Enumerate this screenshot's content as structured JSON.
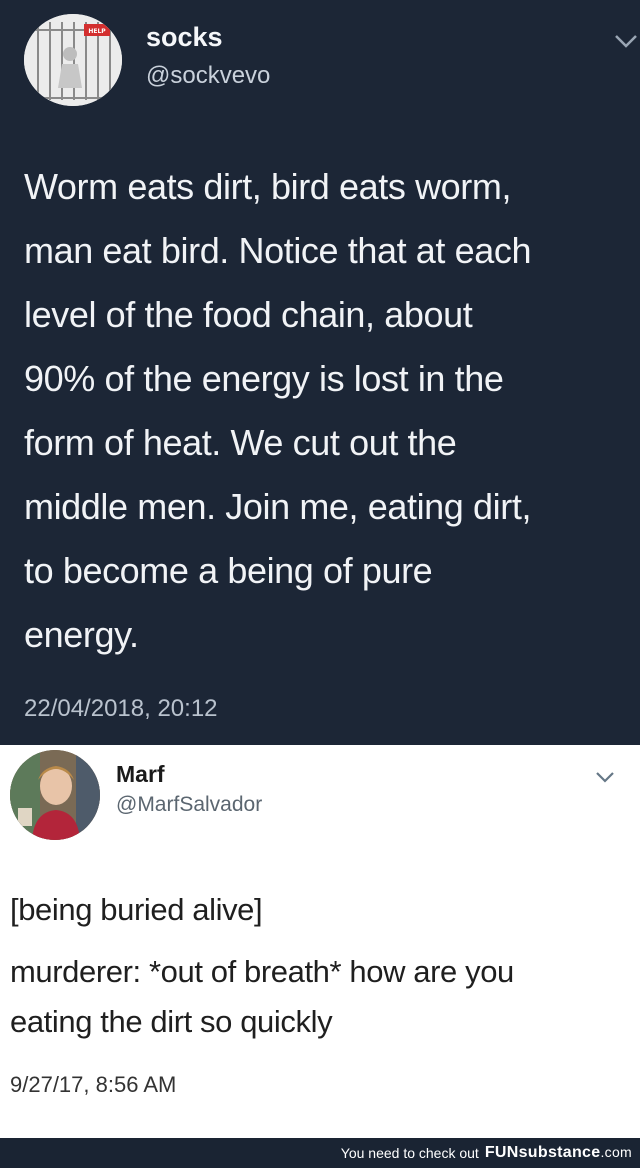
{
  "tweet_1": {
    "author_name": "socks",
    "author_handle": "@sockvevo",
    "avatar_sign_text": "HELP",
    "body_lines": [
      "Worm eats dirt, bird eats worm,",
      "man eat bird. Notice that at each",
      "level of the food chain, about",
      "90% of the energy is lost in the",
      "form of heat. We cut out the",
      "middle men. Join me, eating dirt,",
      "to become a being of pure",
      "energy."
    ],
    "timestamp": "22/04/2018, 20:12",
    "menu_icon": "chevron-down-icon"
  },
  "tweet_2": {
    "author_name": "Marf",
    "author_handle": "@MarfSalvador",
    "paragraph_1": "[being buried alive]",
    "paragraph_2_lines": [
      "murderer: *out of breath* how are you",
      "eating the dirt so quickly"
    ],
    "timestamp": "9/27/17, 8:56 AM",
    "menu_icon": "chevron-down-icon"
  },
  "footer": {
    "text": "You need to check out",
    "brand_fun": "FUN",
    "brand_substance": "substance",
    "brand_domain": ".com"
  },
  "colors": {
    "dark_tweet_bg": "#1c2636",
    "footer_bg": "#1a2433",
    "light_tweet_bg": "#ffffff"
  }
}
